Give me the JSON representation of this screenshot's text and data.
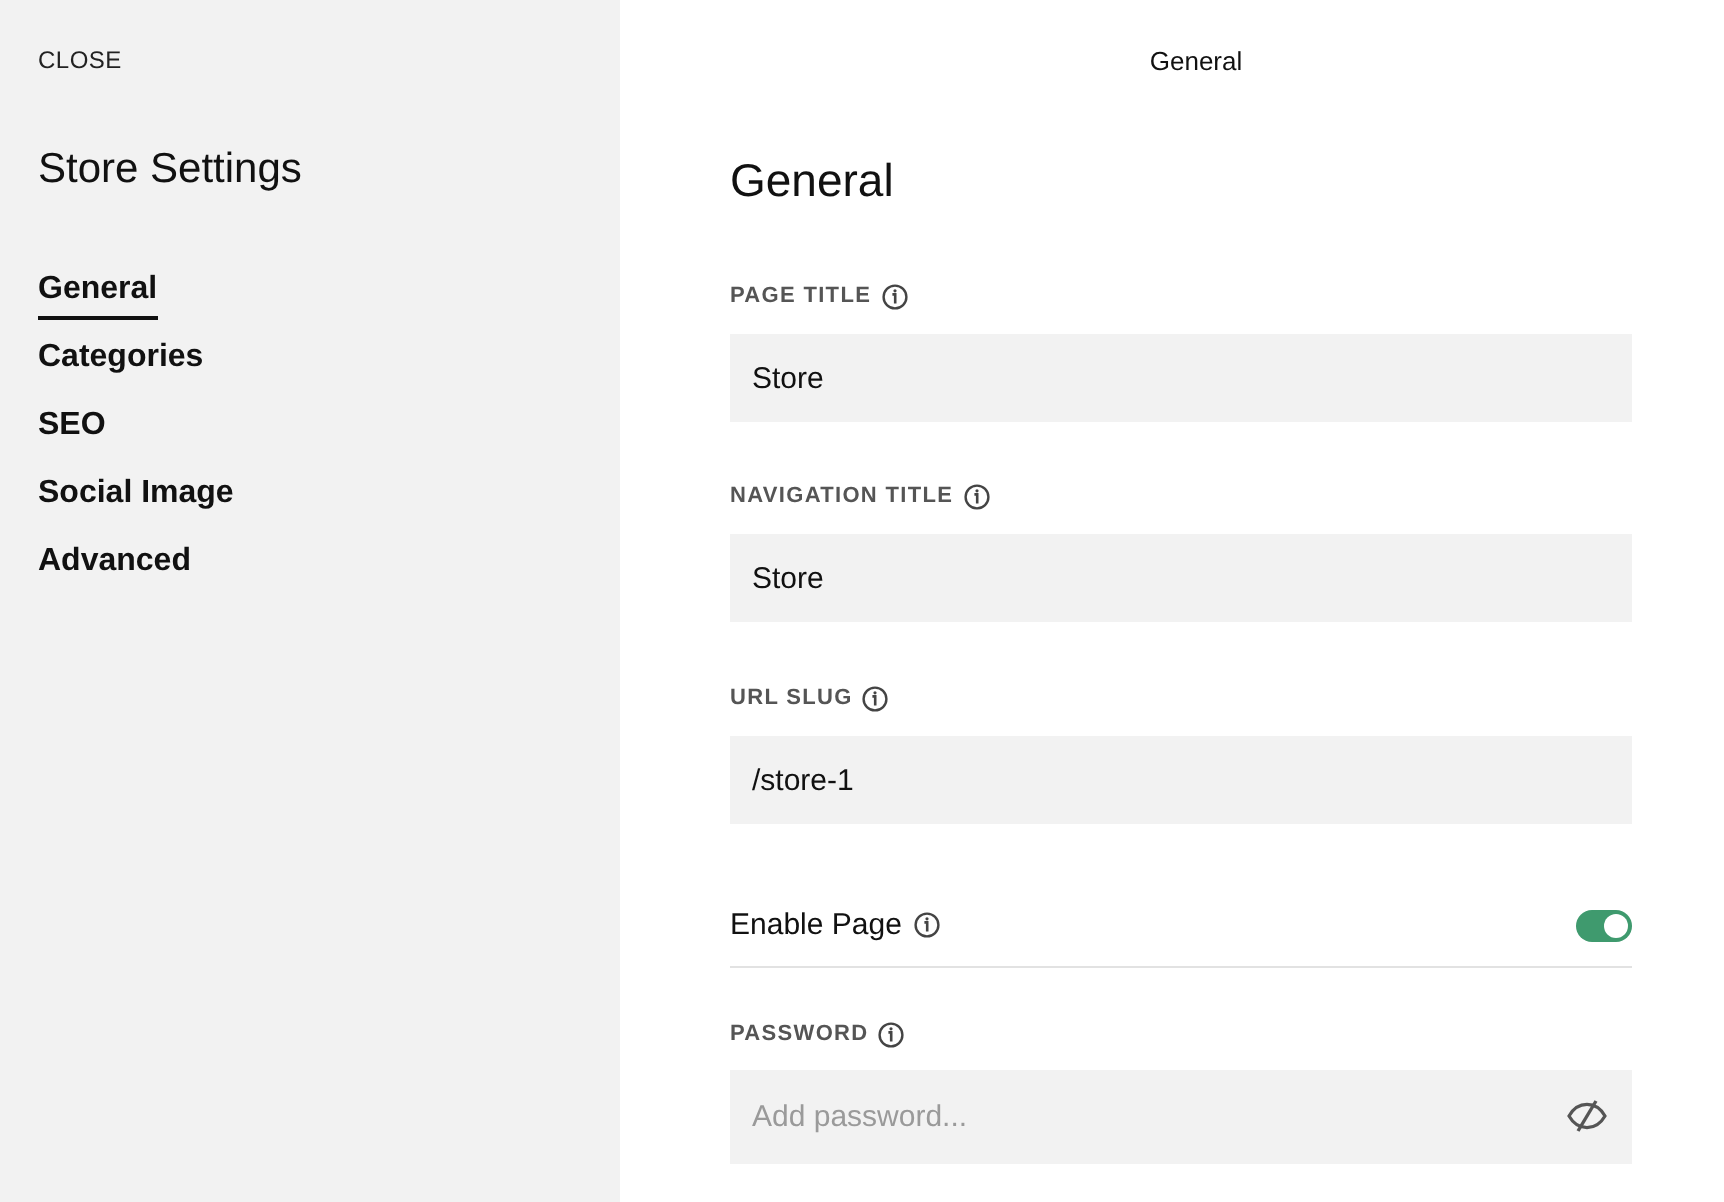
{
  "sidebar": {
    "close": "CLOSE",
    "title": "Store Settings",
    "items": [
      {
        "label": "General",
        "selected": true
      },
      {
        "label": "Categories",
        "selected": false
      },
      {
        "label": "SEO",
        "selected": false
      },
      {
        "label": "Social Image",
        "selected": false
      },
      {
        "label": "Advanced",
        "selected": false
      }
    ]
  },
  "header": {
    "title": "General"
  },
  "panel": {
    "heading": "General",
    "fields": [
      {
        "kind": "text",
        "label": "PAGE TITLE",
        "value": "Store"
      },
      {
        "kind": "text",
        "label": "NAVIGATION TITLE",
        "value": "Store"
      },
      {
        "kind": "text",
        "label": "URL SLUG",
        "value": "/store-1"
      },
      {
        "kind": "toggle",
        "label": "Enable Page",
        "on": true
      },
      {
        "kind": "password",
        "label": "PASSWORD",
        "placeholder": "Add password..."
      }
    ]
  }
}
